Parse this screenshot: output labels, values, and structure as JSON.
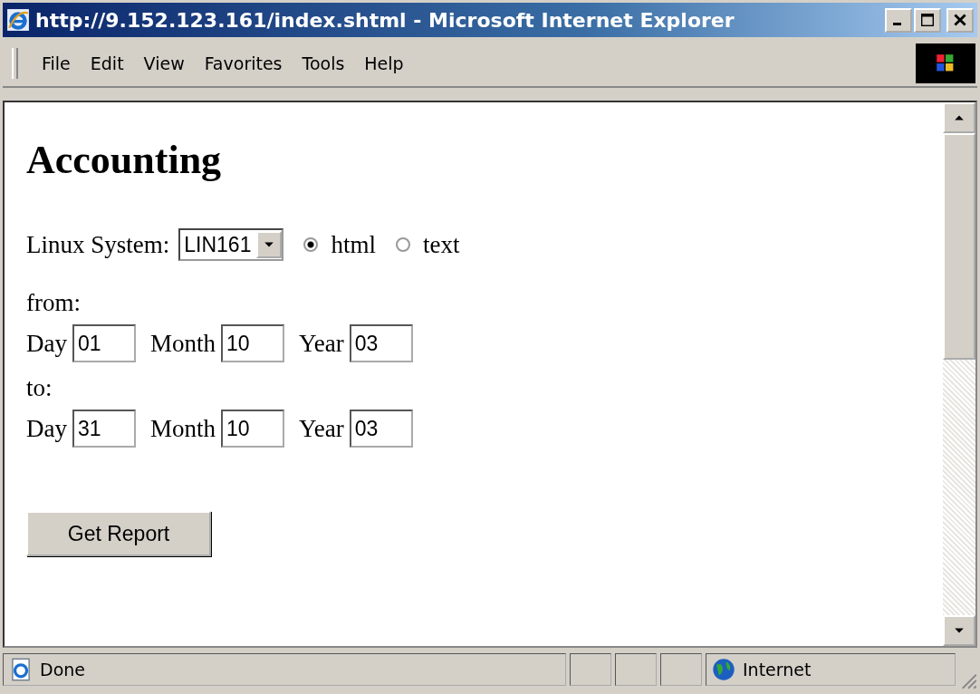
{
  "window": {
    "title": "http://9.152.123.161/index.shtml - Microsoft Internet Explorer"
  },
  "menu": [
    "File",
    "Edit",
    "View",
    "Favorites",
    "Tools",
    "Help"
  ],
  "page": {
    "heading": "Accounting",
    "system_label": "Linux System:",
    "system_value": "LIN161",
    "formats": [
      {
        "label": "html",
        "selected": true
      },
      {
        "label": "text",
        "selected": false
      }
    ],
    "ranges": [
      {
        "label": "from:",
        "fields": [
          {
            "label": "Day",
            "value": "01"
          },
          {
            "label": "Month",
            "value": "10"
          },
          {
            "label": "Year",
            "value": "03"
          }
        ]
      },
      {
        "label": "to:",
        "fields": [
          {
            "label": "Day",
            "value": "31"
          },
          {
            "label": "Month",
            "value": "10"
          },
          {
            "label": "Year",
            "value": "03"
          }
        ]
      }
    ],
    "button": "Get Report"
  },
  "status_bar": {
    "text": "Done",
    "zone": "Internet"
  }
}
